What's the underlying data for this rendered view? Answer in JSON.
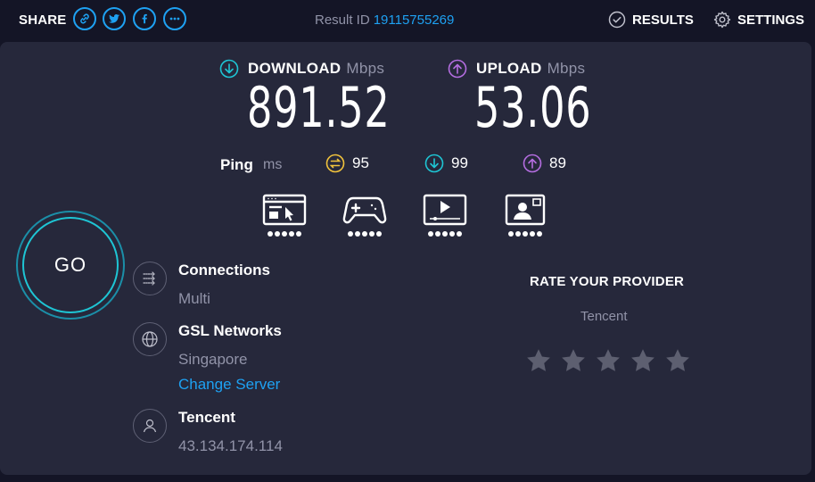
{
  "topbar": {
    "share_label": "SHARE",
    "share_buttons": [
      "link-icon",
      "twitter-icon",
      "facebook-icon",
      "more-icon"
    ],
    "result_id_label": "Result ID",
    "result_id_value": "19115755269",
    "results_label": "RESULTS",
    "settings_label": "SETTINGS"
  },
  "download": {
    "label": "DOWNLOAD",
    "unit": "Mbps",
    "value": "891.52"
  },
  "upload": {
    "label": "UPLOAD",
    "unit": "Mbps",
    "value": "53.06"
  },
  "ping": {
    "label": "Ping",
    "unit": "ms",
    "idle": "95",
    "download": "99",
    "upload": "89"
  },
  "quality": [
    {
      "name": "browsing-icon",
      "dots": 5
    },
    {
      "name": "gaming-icon",
      "dots": 5
    },
    {
      "name": "streaming-icon",
      "dots": 5
    },
    {
      "name": "video-call-icon",
      "dots": 5
    }
  ],
  "go_label": "GO",
  "connections": {
    "title": "Connections",
    "value": "Multi"
  },
  "server": {
    "title": "GSL Networks",
    "location": "Singapore",
    "change_label": "Change Server"
  },
  "provider": {
    "title": "Tencent",
    "ip": "43.134.174.114"
  },
  "rating": {
    "title": "RATE YOUR PROVIDER",
    "provider": "Tencent",
    "stars": 0,
    "max_stars": 5
  },
  "colors": {
    "background": "#141526",
    "panel": "#26283b",
    "accent_blue": "#1ea1f2",
    "download": "#1ec5d4",
    "upload": "#b46de0",
    "ping_idle": "#f1c33c",
    "muted": "#9193a8"
  }
}
